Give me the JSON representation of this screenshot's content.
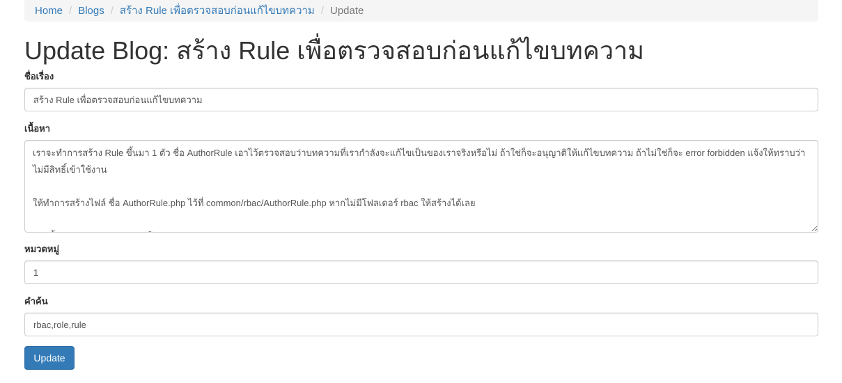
{
  "breadcrumb": {
    "home": "Home",
    "blogs": "Blogs",
    "post": "สร้าง Rule เพื่อตรวจสอบก่อนแก้ไขบทความ",
    "current": "Update",
    "separator": "/"
  },
  "page_title": "Update Blog: สร้าง Rule เพื่อตรวจสอบก่อนแก้ไขบทความ",
  "form": {
    "title_label": "ชื่อเรื่อง",
    "title_value": "สร้าง Rule เพื่อตรวจสอบก่อนแก้ไขบทความ",
    "content_label": "เนื้อหา",
    "content_value": "เราจะทำการสร้าง Rule ขึ้นมา 1 ตัว ชื่อ AuthorRule เอาไว้ตรวจสอบว่าบทความที่เรากำลังจะแก้ไขเป็นของเราจริงหรือไม่ ถ้าใช่ก็จะอนุญาติให้แก้ไขบทความ ถ้าไม่ใช่ก็จะ error forbidden แจ้งให้ทราบว่าไม่มีสิทธิ์เข้าใช้งาน\n\nให้ทำการสร้างไฟล์ ชื่อ AuthorRule.php ไว้ที่ common/rbac/AuthorRule.php หากไม่มีโฟลเดอร์ rbac ให้สร้างได้เลย\n\nจากนั้นทำการสร้าง Rule ตามโค้ดด้านล่าง",
    "category_label": "หมวดหมู่",
    "category_value": "1",
    "tags_label": "คำค้น",
    "tags_value": "rbac,role,rule",
    "submit_label": "Update"
  },
  "colors": {
    "primary": "#337ab7",
    "link": "#337ab7",
    "breadcrumb_bg": "#f5f5f5"
  }
}
